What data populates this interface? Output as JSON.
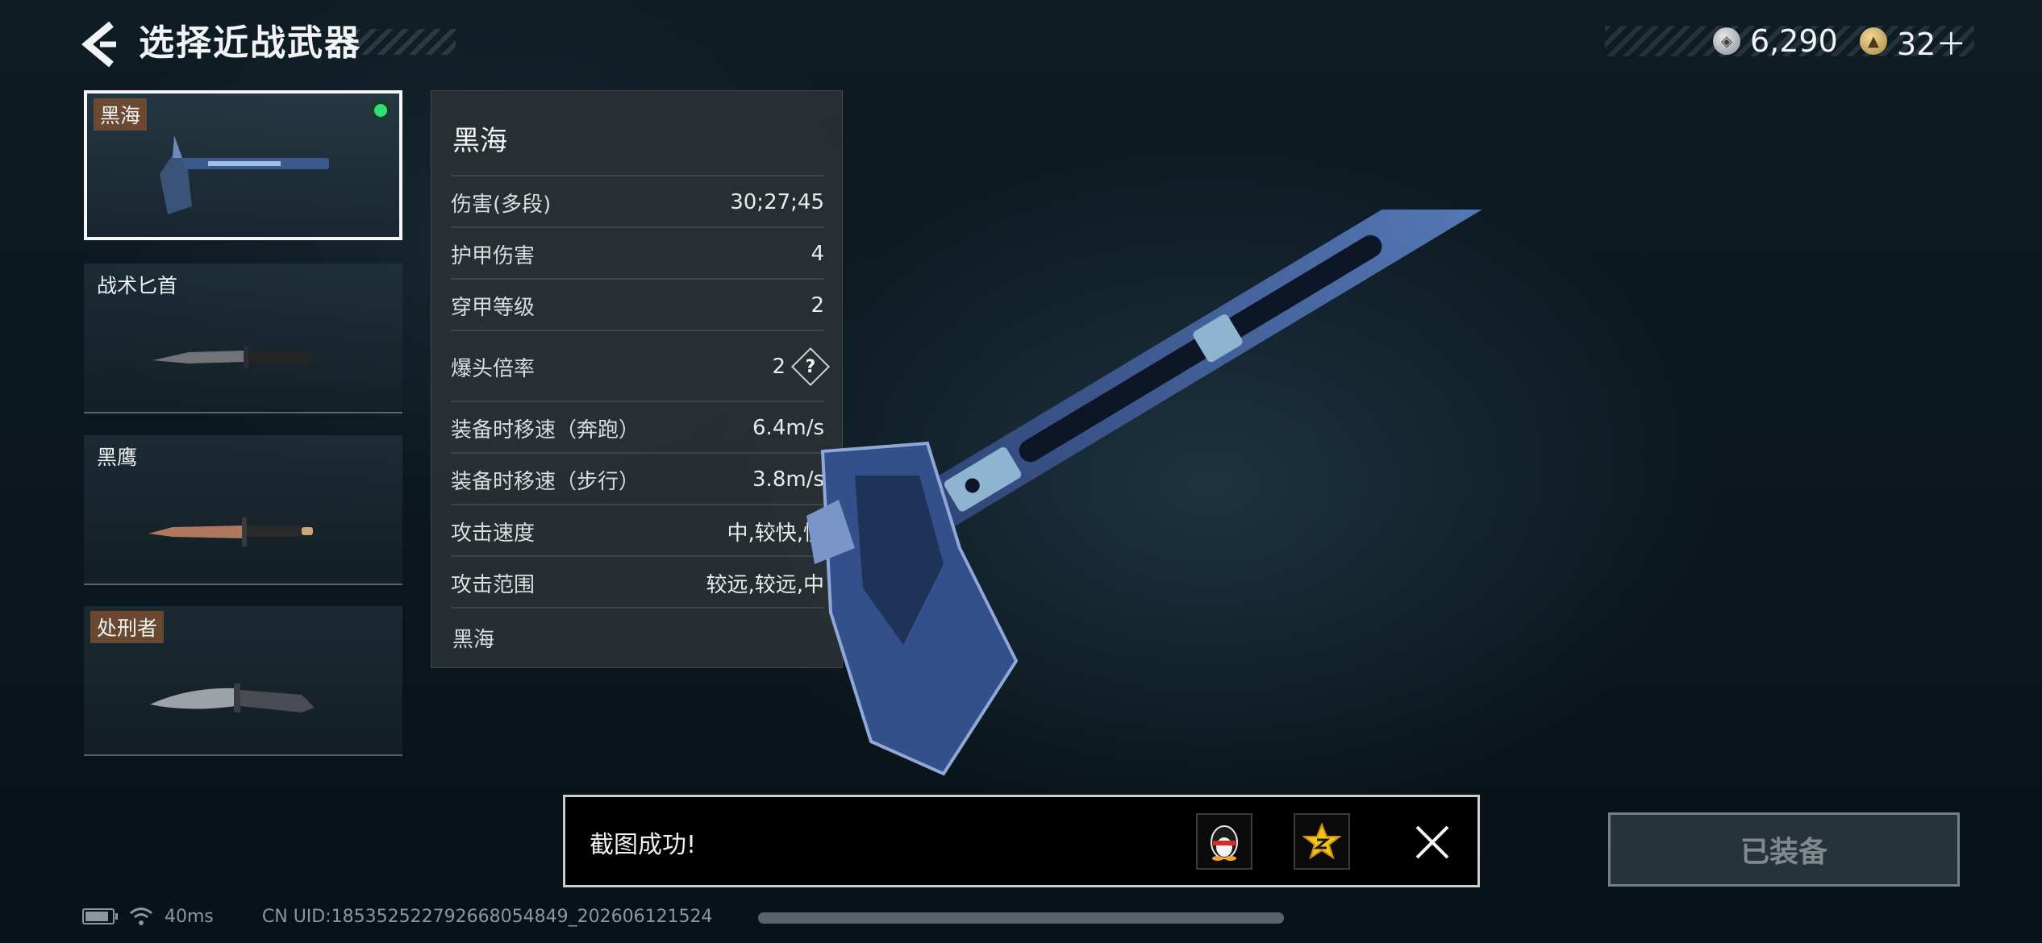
{
  "header": {
    "title": "选择近战武器",
    "currencies": [
      {
        "icon": "silver-coin-icon",
        "value": "6,290"
      },
      {
        "icon": "gold-coin-icon",
        "value": "32＋"
      }
    ]
  },
  "weapons": [
    {
      "name": "黑海",
      "selected": true,
      "equipped": true,
      "icon": "hatchet-icon"
    },
    {
      "name": "战术匕首",
      "selected": false,
      "icon": "tactical-knife-icon"
    },
    {
      "name": "黑鹰",
      "selected": false,
      "icon": "dagger-icon"
    },
    {
      "name": "处刑者",
      "selected": false,
      "icon": "combat-knife-icon"
    }
  ],
  "stats": {
    "title": "黑海",
    "rows": [
      {
        "label": "伤害(多段)",
        "value": "30;27;45"
      },
      {
        "label": "护甲伤害",
        "value": "4"
      },
      {
        "label": "穿甲等级",
        "value": "2"
      },
      {
        "label": "爆头倍率",
        "value": "2"
      },
      {
        "label": "装备时移速（奔跑）",
        "value": "6.4m/s"
      },
      {
        "label": "装备时移速（步行）",
        "value": "3.8m/s"
      },
      {
        "label": "攻击速度",
        "value": "中,较快,慢"
      },
      {
        "label": "攻击范围",
        "value": "较远,较远,中"
      }
    ],
    "footer": "黑海",
    "help_icon": "?"
  },
  "toast": {
    "message": "截图成功!",
    "share_icons": [
      "qq-penguin-icon",
      "qzone-star-icon"
    ]
  },
  "equip_button": "已装备",
  "status": {
    "ping": "40ms",
    "uid": "CN UID:185352522792668054849_202606121524",
    "progress": 1.0
  },
  "colors": {
    "accent_equipped": "#2fe07a",
    "card_tag": "#7a4e30",
    "panel": "#2a3034"
  }
}
